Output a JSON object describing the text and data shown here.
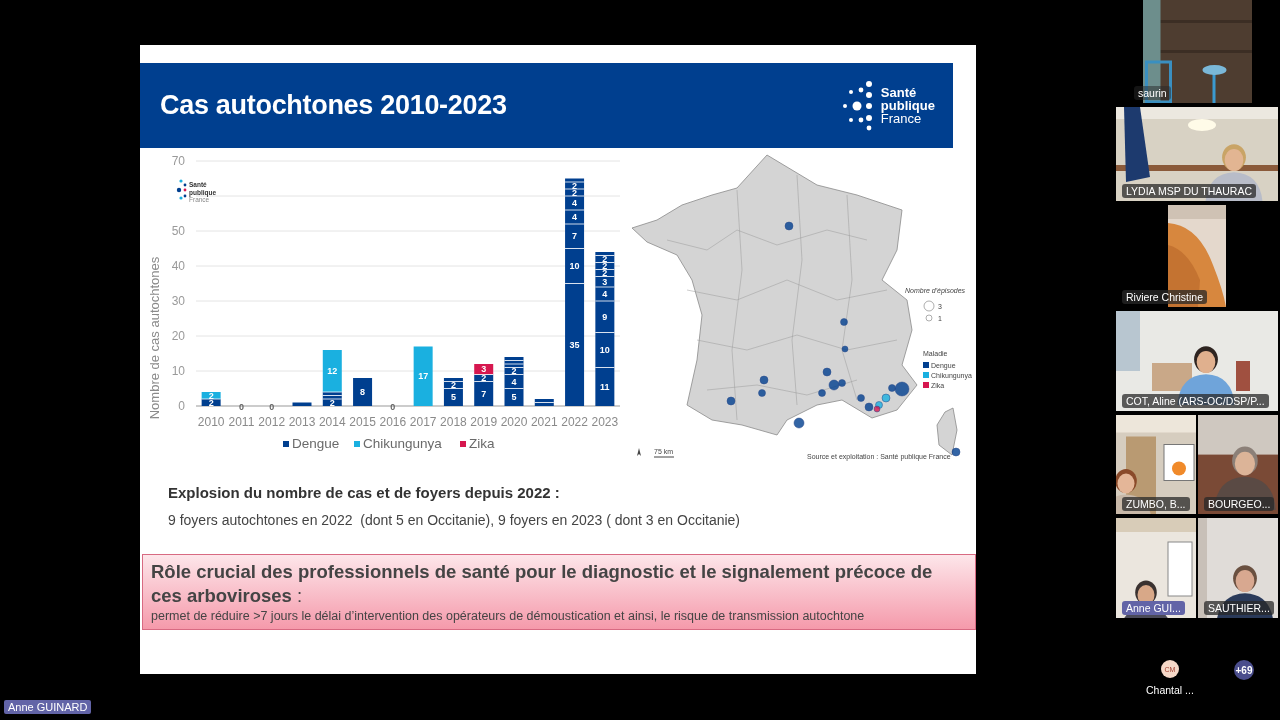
{
  "slide": {
    "title": "Cas autochtones 2010-2023",
    "logo": [
      "Santé",
      "publique",
      "France"
    ],
    "chart": {
      "logo": [
        "Santé",
        "publique",
        "France"
      ],
      "chart_data": {
        "type": "bar",
        "stacked": true,
        "ylabel": "Nombre de cas autochtones",
        "categories": [
          "2010",
          "2011",
          "2012",
          "2013",
          "2014",
          "2015",
          "2016",
          "2017",
          "2018",
          "2019",
          "2020",
          "2021",
          "2022",
          "2023"
        ],
        "series": [
          {
            "name": "Dengue",
            "color": "#003f8f",
            "values": [
              2,
              0,
              0,
              1,
              2,
              8,
              0,
              0,
              5,
              7,
              5,
              1,
              35,
              11
            ]
          },
          {
            "color": "#003f8f",
            "values": [
              0,
              0,
              0,
              0,
              1,
              0,
              0,
              0,
              2,
              2,
              4,
              1,
              10,
              10
            ]
          },
          {
            "color": "#003f8f",
            "values": [
              0,
              0,
              0,
              0,
              1,
              0,
              0,
              0,
              1,
              0,
              2,
              0,
              7,
              9
            ]
          },
          {
            "color": "#003f8f",
            "values": [
              0,
              0,
              0,
              0,
              0,
              0,
              0,
              0,
              0,
              0,
              1,
              0,
              4,
              4
            ]
          },
          {
            "color": "#003f8f",
            "values": [
              0,
              0,
              0,
              0,
              0,
              0,
              0,
              0,
              0,
              0,
              1,
              0,
              4,
              3
            ]
          },
          {
            "color": "#003f8f",
            "values": [
              0,
              0,
              0,
              0,
              0,
              0,
              0,
              0,
              0,
              0,
              1,
              0,
              2,
              2
            ]
          },
          {
            "color": "#003f8f",
            "values": [
              0,
              0,
              0,
              0,
              0,
              0,
              0,
              0,
              0,
              0,
              0,
              0,
              2,
              2
            ]
          },
          {
            "color": "#003f8f",
            "values": [
              0,
              0,
              0,
              0,
              0,
              0,
              0,
              0,
              0,
              0,
              0,
              0,
              1,
              2
            ]
          },
          {
            "color": "#003f8f",
            "values": [
              0,
              0,
              0,
              0,
              0,
              0,
              0,
              0,
              0,
              0,
              0,
              0,
              0,
              1
            ]
          },
          {
            "name": "Chikungunya",
            "color": "#1ab0e0",
            "values": [
              2,
              0,
              0,
              0,
              12,
              0,
              0,
              17,
              0,
              0,
              0,
              0,
              0,
              0
            ]
          },
          {
            "name": "Zika",
            "color": "#d6174f",
            "values": [
              0,
              0,
              0,
              0,
              0,
              0,
              0,
              0,
              0,
              3,
              0,
              0,
              0,
              0
            ]
          }
        ],
        "value_labels": [
          [
            "2",
            "0",
            "0",
            null,
            "2",
            "8",
            "0",
            null,
            "5",
            "7",
            "5",
            null,
            "35",
            "11"
          ],
          [
            null,
            null,
            null,
            null,
            null,
            null,
            null,
            null,
            "2",
            "2",
            "4",
            null,
            "10",
            "10"
          ],
          [
            null,
            null,
            null,
            null,
            null,
            null,
            null,
            null,
            null,
            null,
            "2",
            null,
            "7",
            "9"
          ],
          [
            null,
            null,
            null,
            null,
            null,
            null,
            null,
            null,
            null,
            null,
            null,
            null,
            "4",
            "4"
          ],
          [
            null,
            null,
            null,
            null,
            null,
            null,
            null,
            null,
            null,
            null,
            null,
            null,
            "4",
            "3"
          ],
          [
            null,
            null,
            null,
            null,
            null,
            null,
            null,
            null,
            null,
            null,
            null,
            null,
            "2",
            "2"
          ],
          [
            null,
            null,
            null,
            null,
            null,
            null,
            null,
            null,
            null,
            null,
            null,
            null,
            "2",
            "2"
          ],
          [
            null,
            null,
            null,
            null,
            null,
            null,
            null,
            null,
            null,
            null,
            null,
            null,
            null,
            "2"
          ],
          [
            null,
            null,
            null,
            null,
            null,
            null,
            null,
            null,
            null,
            null,
            null,
            null,
            null,
            null
          ],
          [
            "2",
            null,
            null,
            null,
            "12",
            null,
            null,
            "17",
            null,
            null,
            null,
            null,
            null,
            null
          ],
          [
            null,
            null,
            null,
            null,
            null,
            null,
            null,
            null,
            null,
            "3",
            null,
            null,
            null,
            null
          ]
        ],
        "legend": [
          "Dengue",
          "Chikungunya",
          "Zika"
        ],
        "ylim": [
          0,
          70
        ],
        "yticks": [
          0,
          10,
          20,
          30,
          40,
          50,
          70
        ],
        "grid": true
      }
    },
    "map": {
      "size_title": "Nombre d'épisodes",
      "size_items": [
        "3",
        "1"
      ],
      "legend_title": "Maladie",
      "legend_items": [
        {
          "label": "Dengue",
          "color": "#003f8f"
        },
        {
          "label": "Chikungunya",
          "color": "#1ab0e0"
        },
        {
          "label": "Zika",
          "color": "#d6174f"
        }
      ],
      "scale": "75 km",
      "source": "Source et exploitation : Santé publique France"
    },
    "heading": "Explosion du nombre de cas et de foyers depuis 2022 :",
    "detail": "9 foyers autochtones en 2022  (dont 5 en Occitanie), 9 foyers en 2023 ( dont 3 en Occitanie)",
    "callout": {
      "title": "**Rôle crucial des professionnels de santé pour le diagnostic et le signalement précoce de ces arboviroses** :",
      "text": "permet de réduire >7 jours le délai d’intervention des opérateurs de démoustication et ainsi, le risque de transmission autochtone"
    }
  },
  "participants": [
    {
      "name": "saurin",
      "highlighted": false
    },
    {
      "name": "LYDIA  MSP DU THAURAC",
      "highlighted": false
    },
    {
      "name": "Riviere Christine",
      "highlighted": false
    },
    {
      "name": "COT, Aline (ARS-OC/DSP/P...",
      "highlighted": false
    },
    {
      "name": "ZUMBO, B...",
      "highlighted": false
    },
    {
      "name": "BOURGEO...",
      "highlighted": false
    },
    {
      "name": "Anne GUI...",
      "highlighted": true
    },
    {
      "name": "SAUTHIER...",
      "highlighted": false
    }
  ],
  "others": [
    {
      "initials": "CM",
      "name": "Chantal ..."
    }
  ],
  "more_count": "+69",
  "presenter": "Anne GUINARD"
}
